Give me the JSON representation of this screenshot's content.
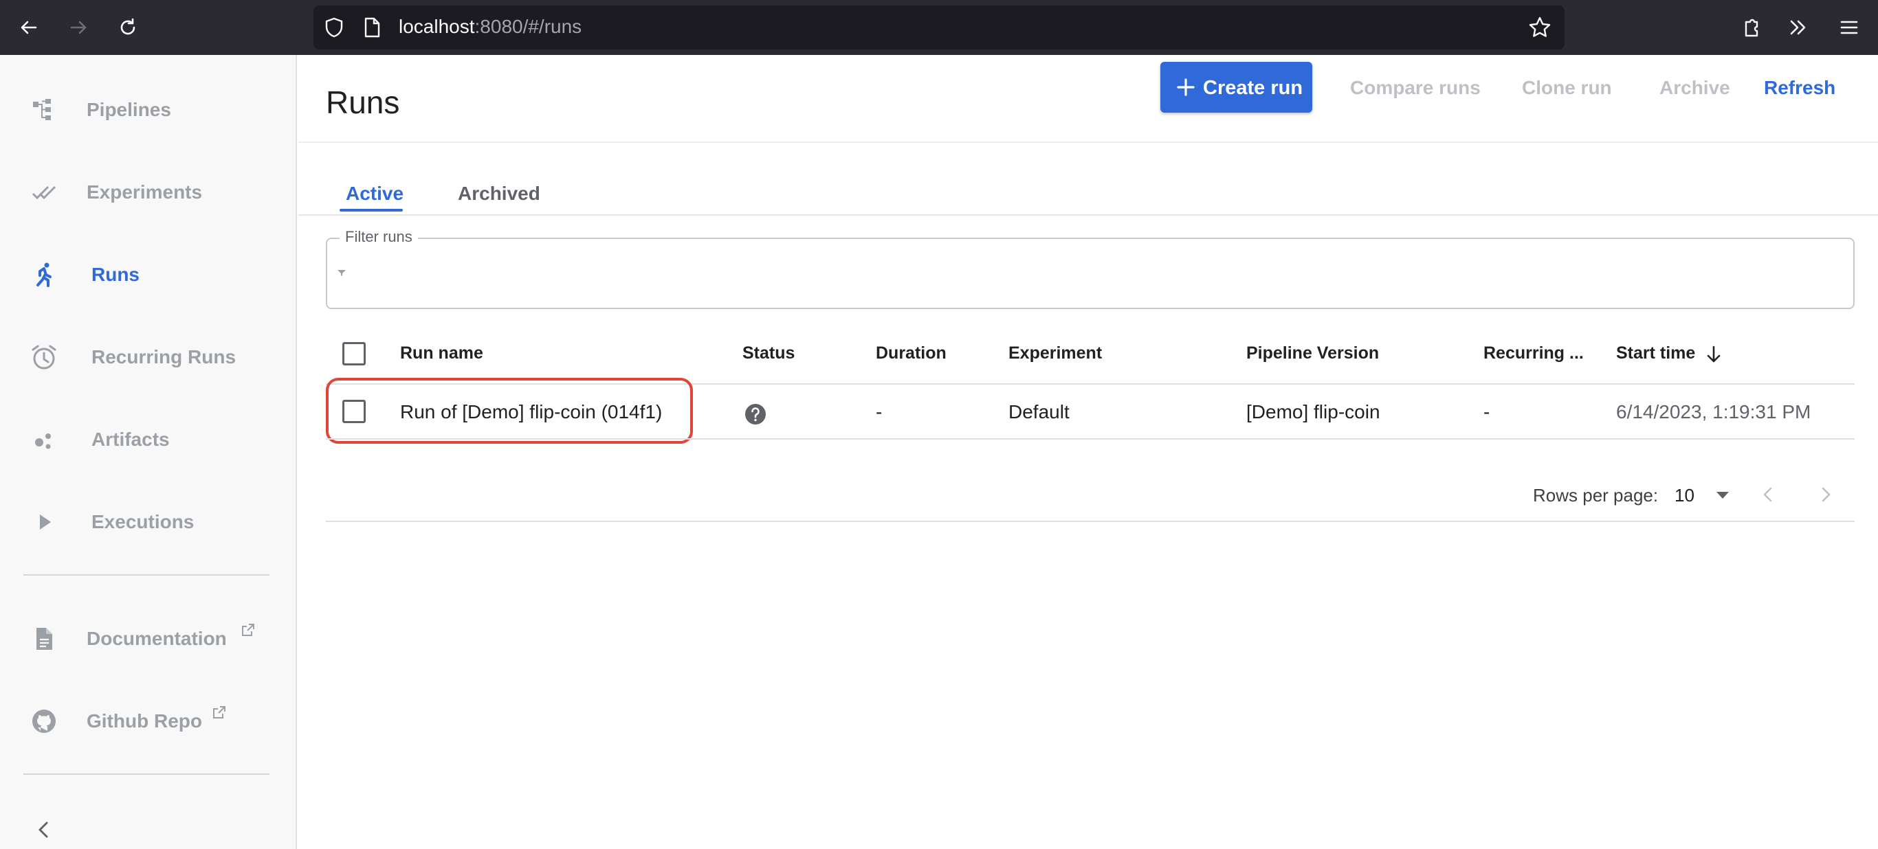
{
  "browser": {
    "url_host": "localhost",
    "url_rest": ":8080/#/runs",
    "icons": [
      "back-arrow-icon",
      "forward-arrow-icon",
      "reload-icon",
      "shield-icon",
      "page-icon",
      "star-icon",
      "extensions-icon",
      "overflow-chevrons-icon",
      "hamburger-menu-icon"
    ]
  },
  "sidebar": {
    "items": [
      {
        "label": "Pipelines",
        "icon": "pipelines-icon"
      },
      {
        "label": "Experiments",
        "icon": "experiments-icon"
      },
      {
        "label": "Runs",
        "icon": "runs-icon",
        "active": true
      },
      {
        "label": "Recurring Runs",
        "icon": "alarm-clock-icon"
      },
      {
        "label": "Artifacts",
        "icon": "artifacts-icon"
      },
      {
        "label": "Executions",
        "icon": "play-icon"
      }
    ],
    "external": [
      {
        "label": "Documentation",
        "icon": "document-icon"
      },
      {
        "label": "Github Repo",
        "icon": "github-icon"
      }
    ]
  },
  "header": {
    "title": "Runs",
    "buttons": {
      "create": "Create run",
      "compare": "Compare runs",
      "clone": "Clone run",
      "archive": "Archive",
      "refresh": "Refresh"
    }
  },
  "tabs": [
    {
      "label": "Active",
      "active": true
    },
    {
      "label": "Archived",
      "active": false
    }
  ],
  "filter": {
    "label": "Filter runs",
    "value": ""
  },
  "table": {
    "columns": [
      "Run name",
      "Status",
      "Duration",
      "Experiment",
      "Pipeline Version",
      "Recurring ...",
      "Start time"
    ],
    "sort_column": "Start time",
    "sort_direction": "descending",
    "rows": [
      {
        "run_name": "Run of [Demo] flip-coin (014f1)",
        "status": "unknown",
        "duration": "-",
        "experiment": "Default",
        "pipeline_version": "[Demo] flip-coin",
        "recurring": "-",
        "start_time": "6/14/2023, 1:19:31 PM"
      }
    ]
  },
  "pagination": {
    "rows_per_page_label": "Rows per page:",
    "rows_per_page_value": "10"
  },
  "colors": {
    "accent": "#2f6ad8",
    "highlight": "#e0453a",
    "sidebar_bg": "#f8f8f9",
    "browser_bar": "#2b2a33"
  }
}
